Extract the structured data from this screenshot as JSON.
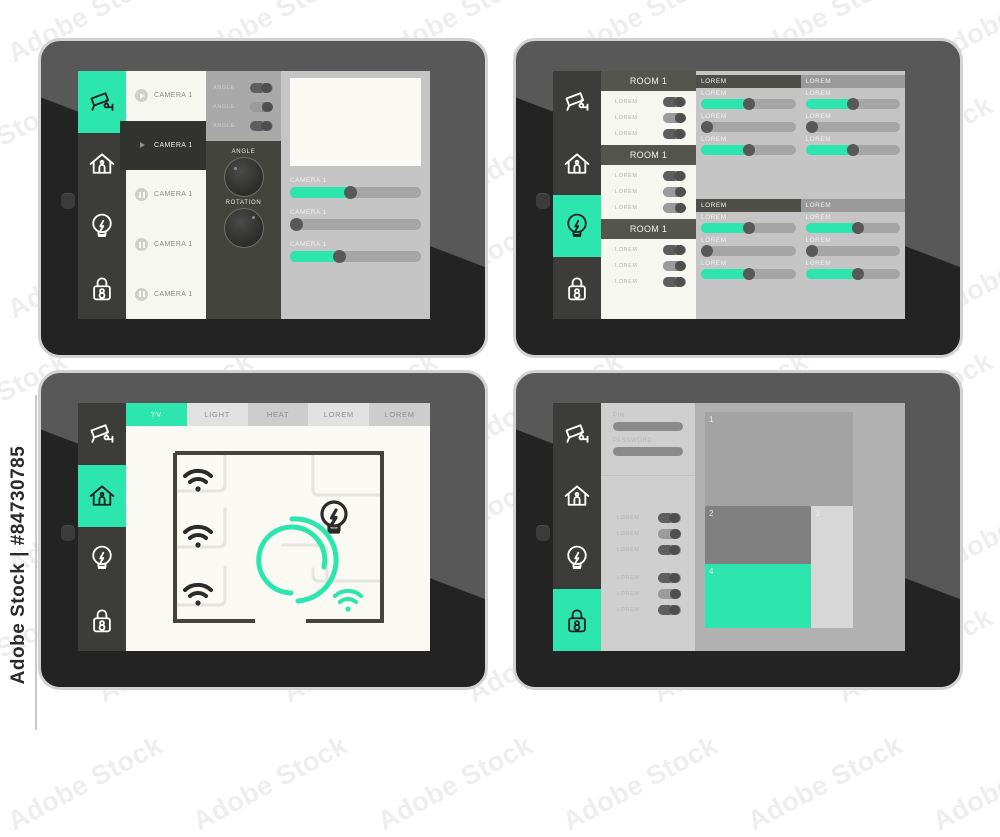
{
  "watermark": {
    "side_text": "Adobe Stock | #84730785",
    "tile_text": "Adobe Stock"
  },
  "colors": {
    "accent": "#2ce6ad",
    "sidebar": "#3c3c3a",
    "panel_gray": "#c5c5c5",
    "dark_panel": "#44443f",
    "screen_bg": "#faf9f4"
  },
  "sidebar_icons": [
    {
      "name": "security-camera-icon",
      "label": "Camera"
    },
    {
      "name": "home-icon",
      "label": "Home"
    },
    {
      "name": "lightbulb-icon",
      "label": "Light"
    },
    {
      "name": "lock-icon",
      "label": "Security"
    }
  ],
  "tablets": [
    {
      "id": "camera-screen",
      "active_sidebar_index": 0,
      "camera_list": [
        {
          "label": "CAMERA 1",
          "state": "play",
          "selected": false
        },
        {
          "label": "CAMERA 1",
          "state": "play",
          "selected": true
        },
        {
          "label": "CAMERA 1",
          "state": "pause",
          "selected": false
        },
        {
          "label": "CAMERA 1",
          "state": "pause",
          "selected": false
        },
        {
          "label": "CAMERA 1",
          "state": "pause",
          "selected": false
        }
      ],
      "angle_toggles": [
        {
          "label": "ANGLE",
          "on": false
        },
        {
          "label": "ANGLE",
          "on": true
        },
        {
          "label": "ANGLE",
          "on": false
        }
      ],
      "knobs": [
        {
          "label": "ANGLE"
        },
        {
          "label": "ROTATION"
        }
      ],
      "sliders": [
        {
          "label": "CAMERA 1",
          "value": 46
        },
        {
          "label": "CAMERA 1",
          "value": 0
        },
        {
          "label": "CAMERA 1",
          "value": 38
        }
      ]
    },
    {
      "id": "lights-screen",
      "active_sidebar_index": 2,
      "rooms": [
        {
          "title": "ROOM 1",
          "rows": [
            {
              "label": "LOREM",
              "on": false
            },
            {
              "label": "LOREM",
              "on": true
            },
            {
              "label": "LOREM",
              "on": false
            }
          ]
        },
        {
          "title": "ROOM 1",
          "rows": [
            {
              "label": "LOREM",
              "on": false
            },
            {
              "label": "LOREM",
              "on": true
            },
            {
              "label": "LOREM",
              "on": true
            }
          ]
        },
        {
          "title": "ROOM 1",
          "rows": [
            {
              "label": "LOREM",
              "on": false
            },
            {
              "label": "LOREM",
              "on": true
            },
            {
              "label": "LOREM",
              "on": true
            }
          ]
        }
      ],
      "groups": [
        {
          "title": "LOREM",
          "header_tone": "dark",
          "sliders": [
            {
              "label": "LOREM",
              "value": 50
            },
            {
              "label": "LOREM",
              "value": 0
            },
            {
              "label": "LOREM",
              "value": 50
            }
          ]
        },
        {
          "title": "LOREM",
          "header_tone": "light",
          "sliders": [
            {
              "label": "LOREM",
              "value": 50
            },
            {
              "label": "LOREM",
              "value": 0
            },
            {
              "label": "LOREM",
              "value": 50
            }
          ]
        },
        {
          "title": "LOREM",
          "header_tone": "dark",
          "sliders": [
            {
              "label": "LOREM",
              "value": 50
            },
            {
              "label": "LOREM",
              "value": 0
            },
            {
              "label": "LOREM",
              "value": 50
            }
          ]
        },
        {
          "title": "LOREM",
          "header_tone": "light",
          "sliders": [
            {
              "label": "LOREM",
              "value": 55
            },
            {
              "label": "LOREM",
              "value": 0
            },
            {
              "label": "LOREM",
              "value": 55
            }
          ]
        }
      ]
    },
    {
      "id": "floorplan-screen",
      "active_sidebar_index": 1,
      "tabs": [
        {
          "label": "TV",
          "state": "active"
        },
        {
          "label": "LIGHT",
          "state": "light"
        },
        {
          "label": "HEAT",
          "state": "dark"
        },
        {
          "label": "LOREM",
          "state": "light"
        },
        {
          "label": "LOREM",
          "state": "dark"
        }
      ],
      "floorplan": {
        "wifi_points": [
          {
            "name": "wifi-icon-room-1",
            "active": false
          },
          {
            "name": "wifi-icon-room-2",
            "active": false
          },
          {
            "name": "wifi-icon-room-3",
            "active": false
          },
          {
            "name": "wifi-icon-living",
            "active": true
          }
        ],
        "light_point": {
          "name": "lightbulb-icon-living",
          "active": false
        },
        "dial": {
          "name": "progress-dial",
          "value": 75
        }
      }
    },
    {
      "id": "security-screen",
      "active_sidebar_index": 3,
      "form": {
        "fields": [
          {
            "label": "PIN",
            "value": ""
          },
          {
            "label": "PASSWORD",
            "value": ""
          }
        ],
        "toggle_groups": [
          [
            {
              "label": "LOREM",
              "on": false
            },
            {
              "label": "LOREM",
              "on": true
            },
            {
              "label": "LOREM",
              "on": false
            }
          ],
          [
            {
              "label": "LOREM",
              "on": false
            },
            {
              "label": "LOREM",
              "on": true
            },
            {
              "label": "LOREM",
              "on": false
            }
          ]
        ]
      },
      "blocks": [
        {
          "label": "1",
          "color": "#a3a3a3"
        },
        {
          "label": "2",
          "color": "#808080"
        },
        {
          "label": "3",
          "color": "#d7d7d7"
        },
        {
          "label": "4",
          "color": "#2ce6ad"
        }
      ]
    }
  ]
}
